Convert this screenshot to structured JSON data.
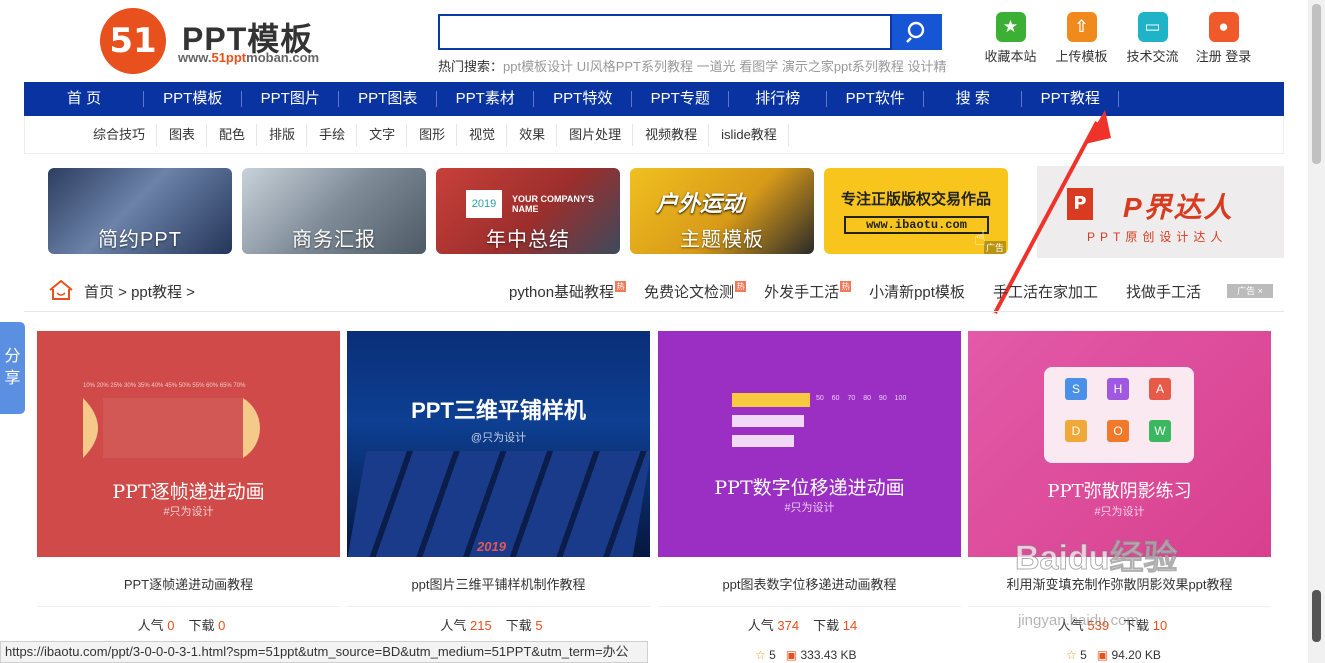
{
  "header": {
    "logo_number": "51",
    "logo_title": "PPT模板",
    "logo_sub_prefix": "www.",
    "logo_sub_hl": "51ppt",
    "logo_sub_suffix": "moban.com",
    "search_value": "",
    "hot_label": "热门搜索：",
    "hot_terms": "ppt模板设计 UI风格PPT系列教程 一道光 看图学 演示之家ppt系列教程 设计精",
    "tools": [
      {
        "label": "收藏本站",
        "icon": "star-icon",
        "color": "#3cb035"
      },
      {
        "label": "上传模板",
        "icon": "upload-icon",
        "color": "#f08a1c"
      },
      {
        "label": "技术交流",
        "icon": "chat-icon",
        "color": "#1fb3c8"
      },
      {
        "label": "注册 登录",
        "icon": "user-icon",
        "color": "#f05a2a"
      }
    ]
  },
  "nav": [
    "首 页",
    "PPT模板",
    "PPT图片",
    "PPT图表",
    "PPT素材",
    "PPT特效",
    "PPT专题",
    "排行榜",
    "PPT软件",
    "搜 索",
    "PPT教程"
  ],
  "subnav": [
    "综合技巧",
    "图表",
    "配色",
    "排版",
    "手绘",
    "文字",
    "图形",
    "视觉",
    "效果",
    "图片处理",
    "视频教程",
    "islide教程"
  ],
  "banners": [
    {
      "label": "简约PPT",
      "bg": "#3a4d6e"
    },
    {
      "label": "商务汇报",
      "bg": "#8a9aa8"
    },
    {
      "label": "年中总结",
      "bg": "#b23a36",
      "badge": "2019",
      "small": "YOUR COMPANY'S NAME"
    },
    {
      "label": "主题模板",
      "bg": "#e8b020",
      "small": "户外运动"
    },
    {
      "title": "专注正版版权交易作品",
      "url": "www.ibaotu.com",
      "ad": "广告"
    }
  ],
  "pjie": {
    "logo": "P",
    "title": "P界达人",
    "sub": "PPT原创设计达人"
  },
  "breadcrumb": "首页 > ppt教程 >",
  "hotlinks": [
    "python基础教程",
    "免费论文检测",
    "外发手工活",
    "小清新ppt模板",
    "手工活在家加工",
    "找做手工活"
  ],
  "hot_tag": "热",
  "ad_close": "广告 ×",
  "share": [
    "分",
    "享"
  ],
  "cards": [
    {
      "thumb_title": "PPT逐帧递进动画",
      "thumb_sub": "#只为设计",
      "percent_row": "10% 20% 25% 30% 35% 40% 45% 50% 55% 60% 65% 70%",
      "title": "PPT逐帧递进动画教程",
      "pop_label": "人气",
      "pop": "0",
      "dl_label": "下载",
      "dl": "0",
      "bg": "#cf4a48"
    },
    {
      "thumb_title": "PPT三维平铺样机",
      "thumb_sub": "@只为设计",
      "badge": "2019",
      "title": "ppt图片三维平铺样机制作教程",
      "pop_label": "人气",
      "pop": "215",
      "dl_label": "下载",
      "dl": "5",
      "bg": "#0f3d86"
    },
    {
      "thumb_title": "PPT数字位移递进动画",
      "thumb_sub": "#只为设计",
      "scale": "50 60 70 80 90 100",
      "title": "ppt图表数字位移递进动画教程",
      "pop_label": "人气",
      "pop": "374",
      "dl_label": "下载",
      "dl": "14",
      "bg": "#9b2fc4"
    },
    {
      "thumb_title": "PPT弥散阴影练习",
      "thumb_sub": "#只为设计",
      "letters": [
        "S",
        "H",
        "A",
        "D",
        "O",
        "W"
      ],
      "title": "利用渐变填充制作弥散阴影效果ppt教程",
      "pop_label": "人气",
      "pop": "539",
      "dl_label": "下载",
      "dl": "10",
      "bg": "#d94aa8"
    }
  ],
  "bottom_items": [
    {
      "stars": "5",
      "size": "333.43 KB"
    },
    {
      "stars": "5",
      "size": "94.20 KB"
    }
  ],
  "status_url": "https://ibaotu.com/ppt/3-0-0-0-3-1.html?spm=51ppt&utm_source=BD&utm_medium=51PPT&utm_term=办公",
  "watermark": "Baidu经验",
  "watermark_sub": "jingyan.baidu.com"
}
